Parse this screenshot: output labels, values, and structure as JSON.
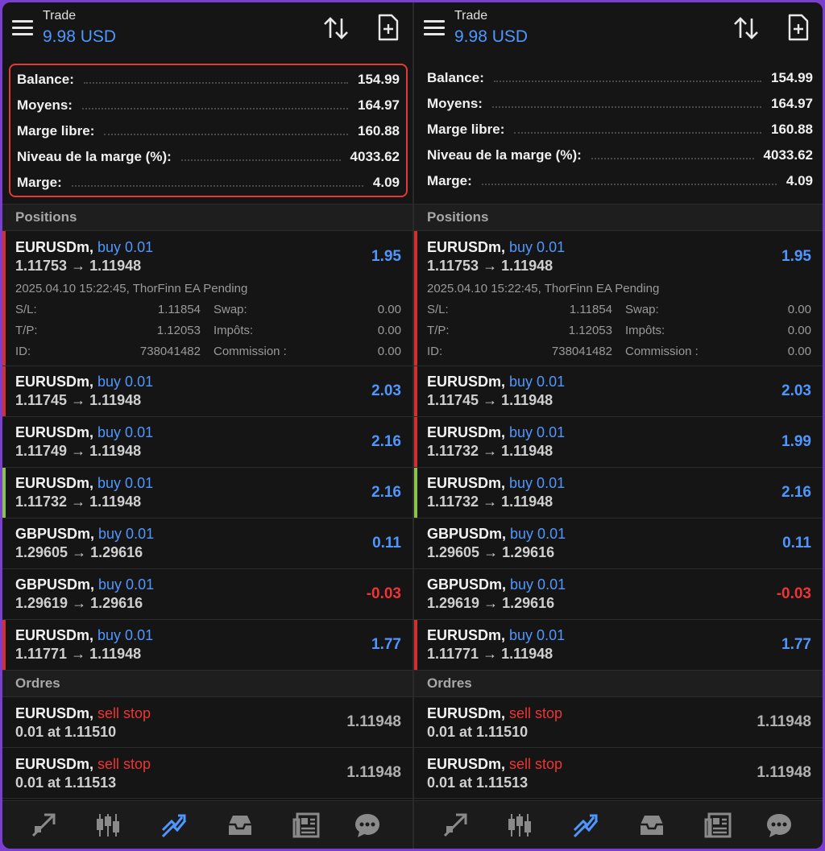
{
  "header": {
    "title": "Trade",
    "balance": "9.98 USD",
    "icons": [
      "menu-icon",
      "sort-icon",
      "new-order-icon"
    ]
  },
  "account": [
    {
      "label": "Balance:",
      "value": "154.99"
    },
    {
      "label": "Moyens:",
      "value": "164.97"
    },
    {
      "label": "Marge libre:",
      "value": "160.88"
    },
    {
      "label": "Niveau de la marge (%):",
      "value": "4033.62"
    },
    {
      "label": "Marge:",
      "value": "4.09"
    }
  ],
  "sections": {
    "positions": "Positions",
    "orders": "Ordres"
  },
  "left": {
    "expanded": {
      "symbol": "EURUSDm,",
      "side": "buy 0.01",
      "prices": "1.11753 → 1.11948",
      "profit": "1.95",
      "datetime": "2025.04.10 15:22:45, ThorFinn EA Pending",
      "details": [
        {
          "k1": "S/L:",
          "v1": "1.11854",
          "k2": "Swap:",
          "v2": "0.00"
        },
        {
          "k1": "T/P:",
          "v1": "1.12053",
          "k2": "Impôts:",
          "v2": "0.00"
        },
        {
          "k1": "ID:",
          "v1": "738041482",
          "k2": "Commission :",
          "v2": "0.00"
        }
      ]
    },
    "positions": [
      {
        "symbol": "EURUSDm,",
        "side": "buy 0.01",
        "prices": "1.11745 → 1.11948",
        "profit": "2.03",
        "bar": "#d32f2f",
        "neg": false
      },
      {
        "symbol": "EURUSDm,",
        "side": "buy 0.01",
        "prices": "1.11749 → 1.11948",
        "profit": "2.16",
        "bar": "",
        "neg": false
      },
      {
        "symbol": "EURUSDm,",
        "side": "buy 0.01",
        "prices": "1.11732 → 1.11948",
        "profit": "2.16",
        "bar": "#8bc34a",
        "neg": false
      },
      {
        "symbol": "GBPUSDm,",
        "side": "buy 0.01",
        "prices": "1.29605 → 1.29616",
        "profit": "0.11",
        "bar": "",
        "neg": false
      },
      {
        "symbol": "GBPUSDm,",
        "side": "buy 0.01",
        "prices": "1.29619 → 1.29616",
        "profit": "-0.03",
        "bar": "",
        "neg": true
      },
      {
        "symbol": "EURUSDm,",
        "side": "buy 0.01",
        "prices": "1.11771 → 1.11948",
        "profit": "1.77",
        "bar": "#d32f2f",
        "neg": false
      }
    ]
  },
  "right": {
    "expanded": {
      "symbol": "EURUSDm,",
      "side": "buy 0.01",
      "prices": "1.11753 → 1.11948",
      "profit": "1.95",
      "datetime": "2025.04.10 15:22:45, ThorFinn EA Pending",
      "details": [
        {
          "k1": "S/L:",
          "v1": "1.11854",
          "k2": "Swap:",
          "v2": "0.00"
        },
        {
          "k1": "T/P:",
          "v1": "1.12053",
          "k2": "Impôts:",
          "v2": "0.00"
        },
        {
          "k1": "ID:",
          "v1": "738041482",
          "k2": "Commission :",
          "v2": "0.00"
        }
      ]
    },
    "positions": [
      {
        "symbol": "EURUSDm,",
        "side": "buy 0.01",
        "prices": "1.11745 → 1.11948",
        "profit": "2.03",
        "bar": "#d32f2f",
        "neg": false
      },
      {
        "symbol": "EURUSDm,",
        "side": "buy 0.01",
        "prices": "1.11732 → 1.11948",
        "profit": "1.99",
        "bar": "#d32f2f",
        "neg": false
      },
      {
        "symbol": "EURUSDm,",
        "side": "buy 0.01",
        "prices": "1.11732 → 1.11948",
        "profit": "2.16",
        "bar": "#8bc34a",
        "neg": false
      },
      {
        "symbol": "GBPUSDm,",
        "side": "buy 0.01",
        "prices": "1.29605 → 1.29616",
        "profit": "0.11",
        "bar": "",
        "neg": false
      },
      {
        "symbol": "GBPUSDm,",
        "side": "buy 0.01",
        "prices": "1.29619 → 1.29616",
        "profit": "-0.03",
        "bar": "",
        "neg": true
      },
      {
        "symbol": "EURUSDm,",
        "side": "buy 0.01",
        "prices": "1.11771 → 1.11948",
        "profit": "1.77",
        "bar": "#d32f2f",
        "neg": false
      }
    ]
  },
  "orders": [
    {
      "symbol": "EURUSDm,",
      "type": "sell stop",
      "qty": "0.01 at 1.11510",
      "price": "1.11948"
    },
    {
      "symbol": "EURUSDm,",
      "type": "sell stop",
      "qty": "0.01 at 1.11513",
      "price": "1.11948"
    }
  ],
  "nav": [
    "chart-trend-icon",
    "candlestick-icon",
    "trade-icon",
    "inbox-icon",
    "news-icon",
    "chat-icon"
  ],
  "colors": {
    "accent": "#4f97ff",
    "negative": "#ee3434",
    "background": "#151515",
    "highlight_border": "#e53935"
  }
}
